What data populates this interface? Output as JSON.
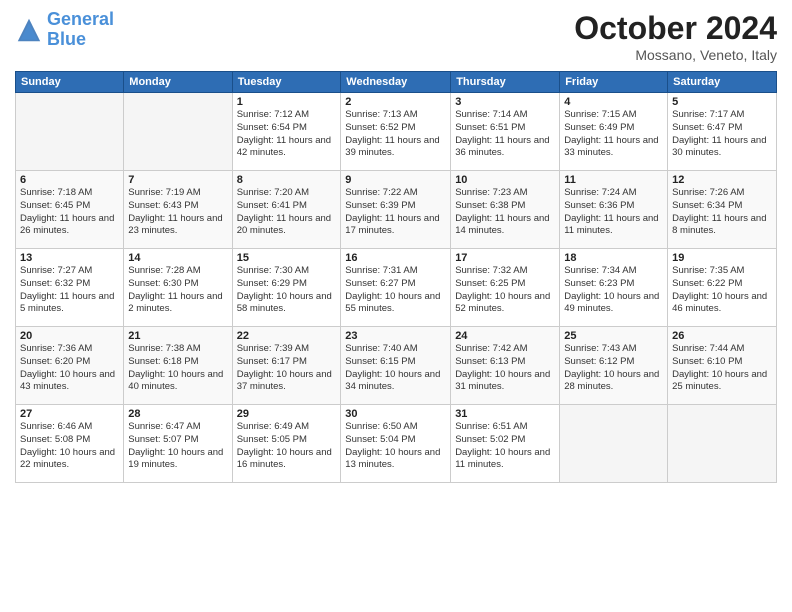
{
  "header": {
    "logo_general": "General",
    "logo_blue": "Blue",
    "month_title": "October 2024",
    "location": "Mossano, Veneto, Italy"
  },
  "days_of_week": [
    "Sunday",
    "Monday",
    "Tuesday",
    "Wednesday",
    "Thursday",
    "Friday",
    "Saturday"
  ],
  "weeks": [
    [
      {
        "day": "",
        "empty": true
      },
      {
        "day": "",
        "empty": true
      },
      {
        "day": "1",
        "sunrise": "7:12 AM",
        "sunset": "6:54 PM",
        "daylight": "11 hours and 42 minutes."
      },
      {
        "day": "2",
        "sunrise": "7:13 AM",
        "sunset": "6:52 PM",
        "daylight": "11 hours and 39 minutes."
      },
      {
        "day": "3",
        "sunrise": "7:14 AM",
        "sunset": "6:51 PM",
        "daylight": "11 hours and 36 minutes."
      },
      {
        "day": "4",
        "sunrise": "7:15 AM",
        "sunset": "6:49 PM",
        "daylight": "11 hours and 33 minutes."
      },
      {
        "day": "5",
        "sunrise": "7:17 AM",
        "sunset": "6:47 PM",
        "daylight": "11 hours and 30 minutes."
      }
    ],
    [
      {
        "day": "6",
        "sunrise": "7:18 AM",
        "sunset": "6:45 PM",
        "daylight": "11 hours and 26 minutes."
      },
      {
        "day": "7",
        "sunrise": "7:19 AM",
        "sunset": "6:43 PM",
        "daylight": "11 hours and 23 minutes."
      },
      {
        "day": "8",
        "sunrise": "7:20 AM",
        "sunset": "6:41 PM",
        "daylight": "11 hours and 20 minutes."
      },
      {
        "day": "9",
        "sunrise": "7:22 AM",
        "sunset": "6:39 PM",
        "daylight": "11 hours and 17 minutes."
      },
      {
        "day": "10",
        "sunrise": "7:23 AM",
        "sunset": "6:38 PM",
        "daylight": "11 hours and 14 minutes."
      },
      {
        "day": "11",
        "sunrise": "7:24 AM",
        "sunset": "6:36 PM",
        "daylight": "11 hours and 11 minutes."
      },
      {
        "day": "12",
        "sunrise": "7:26 AM",
        "sunset": "6:34 PM",
        "daylight": "11 hours and 8 minutes."
      }
    ],
    [
      {
        "day": "13",
        "sunrise": "7:27 AM",
        "sunset": "6:32 PM",
        "daylight": "11 hours and 5 minutes."
      },
      {
        "day": "14",
        "sunrise": "7:28 AM",
        "sunset": "6:30 PM",
        "daylight": "11 hours and 2 minutes."
      },
      {
        "day": "15",
        "sunrise": "7:30 AM",
        "sunset": "6:29 PM",
        "daylight": "10 hours and 58 minutes."
      },
      {
        "day": "16",
        "sunrise": "7:31 AM",
        "sunset": "6:27 PM",
        "daylight": "10 hours and 55 minutes."
      },
      {
        "day": "17",
        "sunrise": "7:32 AM",
        "sunset": "6:25 PM",
        "daylight": "10 hours and 52 minutes."
      },
      {
        "day": "18",
        "sunrise": "7:34 AM",
        "sunset": "6:23 PM",
        "daylight": "10 hours and 49 minutes."
      },
      {
        "day": "19",
        "sunrise": "7:35 AM",
        "sunset": "6:22 PM",
        "daylight": "10 hours and 46 minutes."
      }
    ],
    [
      {
        "day": "20",
        "sunrise": "7:36 AM",
        "sunset": "6:20 PM",
        "daylight": "10 hours and 43 minutes."
      },
      {
        "day": "21",
        "sunrise": "7:38 AM",
        "sunset": "6:18 PM",
        "daylight": "10 hours and 40 minutes."
      },
      {
        "day": "22",
        "sunrise": "7:39 AM",
        "sunset": "6:17 PM",
        "daylight": "10 hours and 37 minutes."
      },
      {
        "day": "23",
        "sunrise": "7:40 AM",
        "sunset": "6:15 PM",
        "daylight": "10 hours and 34 minutes."
      },
      {
        "day": "24",
        "sunrise": "7:42 AM",
        "sunset": "6:13 PM",
        "daylight": "10 hours and 31 minutes."
      },
      {
        "day": "25",
        "sunrise": "7:43 AM",
        "sunset": "6:12 PM",
        "daylight": "10 hours and 28 minutes."
      },
      {
        "day": "26",
        "sunrise": "7:44 AM",
        "sunset": "6:10 PM",
        "daylight": "10 hours and 25 minutes."
      }
    ],
    [
      {
        "day": "27",
        "sunrise": "6:46 AM",
        "sunset": "5:08 PM",
        "daylight": "10 hours and 22 minutes."
      },
      {
        "day": "28",
        "sunrise": "6:47 AM",
        "sunset": "5:07 PM",
        "daylight": "10 hours and 19 minutes."
      },
      {
        "day": "29",
        "sunrise": "6:49 AM",
        "sunset": "5:05 PM",
        "daylight": "10 hours and 16 minutes."
      },
      {
        "day": "30",
        "sunrise": "6:50 AM",
        "sunset": "5:04 PM",
        "daylight": "10 hours and 13 minutes."
      },
      {
        "day": "31",
        "sunrise": "6:51 AM",
        "sunset": "5:02 PM",
        "daylight": "10 hours and 11 minutes."
      },
      {
        "day": "",
        "empty": true
      },
      {
        "day": "",
        "empty": true
      }
    ]
  ],
  "labels": {
    "sunrise_prefix": "Sunrise:",
    "sunset_prefix": "Sunset:",
    "daylight_prefix": "Daylight:"
  }
}
